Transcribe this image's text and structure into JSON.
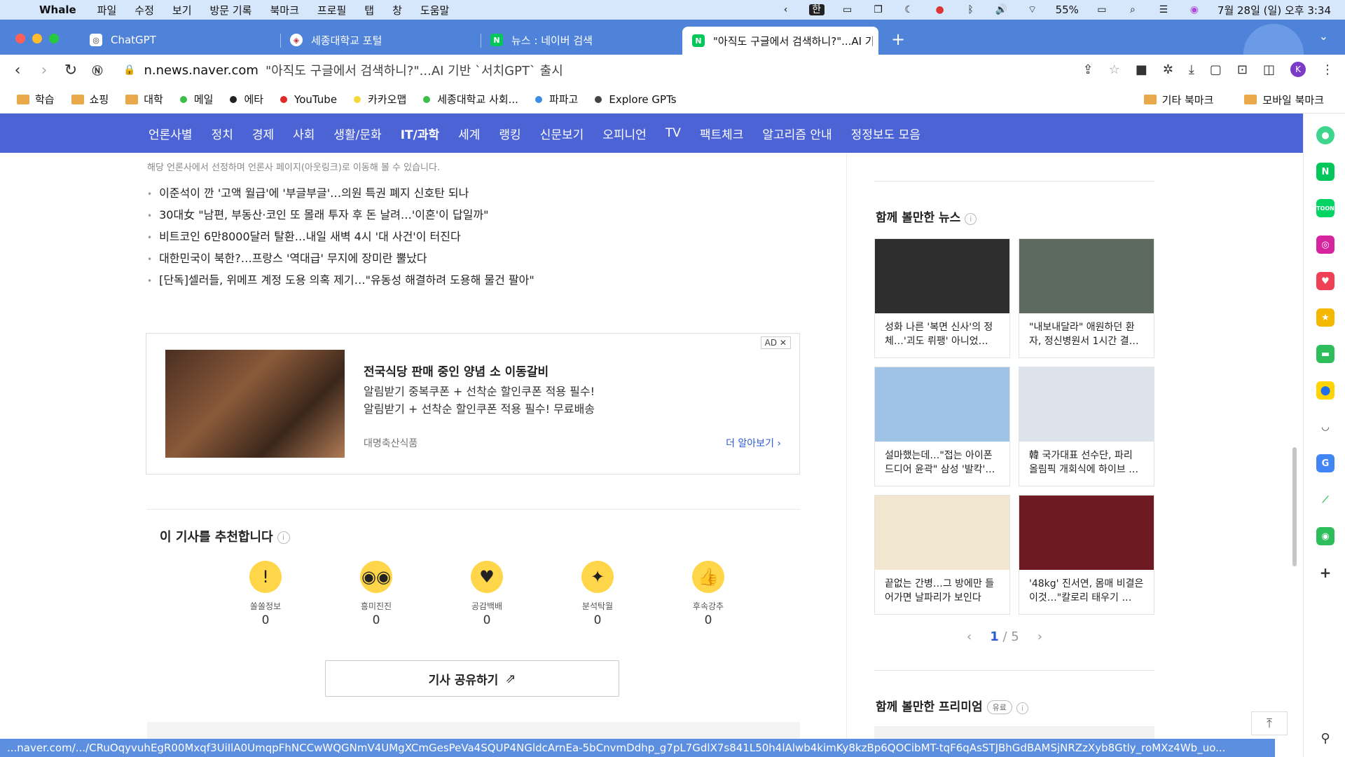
{
  "menubar": {
    "app_name": "Whale",
    "items": [
      "파일",
      "수정",
      "보기",
      "방문 기록",
      "북마크",
      "프로필",
      "탭",
      "창",
      "도움말"
    ],
    "ime": "한",
    "battery": "55%",
    "datetime": "7월 28일 (일) 오후 3:34"
  },
  "tabs": [
    {
      "title": "ChatGPT",
      "icon": "chatgpt-icon"
    },
    {
      "title": "세종대학교 포털",
      "icon": "sejong-icon"
    },
    {
      "title": "뉴스 : 네이버 검색",
      "icon": "naver-icon"
    },
    {
      "title": "\"아직도 구글에서 검색하니?\"...AI 기",
      "icon": "naver-icon",
      "active": true
    }
  ],
  "toolbar": {
    "host": "n.news.naver.com",
    "path": "\"아직도 구글에서 검색하니?\"...AI 기반 `서치GPT` 출시",
    "avatar": "K"
  },
  "bookmarks": {
    "items": [
      {
        "label": "학습",
        "type": "folder"
      },
      {
        "label": "쇼핑",
        "type": "folder"
      },
      {
        "label": "대학",
        "type": "folder"
      },
      {
        "label": "메일",
        "type": "dot",
        "color": "#3cbf4a"
      },
      {
        "label": "에타",
        "type": "dot",
        "color": "#222222"
      },
      {
        "label": "YouTube",
        "type": "dot",
        "color": "#e02a2a"
      },
      {
        "label": "카카오맵",
        "type": "dot",
        "color": "#f5d83b"
      },
      {
        "label": "세종대학교 사회...",
        "type": "dot",
        "color": "#3cbf4a"
      },
      {
        "label": "파파고",
        "type": "dot",
        "color": "#3a8ee6"
      },
      {
        "label": "Explore GPTs",
        "type": "dot",
        "color": "#444444"
      }
    ],
    "right": [
      "기타 북마크",
      "모바일 북마크"
    ]
  },
  "section_nav": [
    "언론사별",
    "정치",
    "경제",
    "사회",
    "생활/문화",
    "IT/과학",
    "세계",
    "랭킹",
    "신문보기",
    "오피니언",
    "TV",
    "팩트체크",
    "알고리즘 안내",
    "정정보도 모음"
  ],
  "section_nav_active": "IT/과학",
  "main": {
    "disclaimer": "해당 언론사에서 선정하며 언론사 페이지(아웃링크)로 이동해 볼 수 있습니다.",
    "headlines": [
      "이준석이 깐 '고액 월급'에 '부글부글'…의원 특권 폐지 신호탄 되나",
      "30대女 \"남편, 부동산·코인 또 몰래 투자 후 돈 날려…'이혼'이 답일까\"",
      "비트코인 6만8000달러 탈환…내일 새벽 4시 '대 사건'이 터진다",
      "대한민국이 북한?…프랑스 '역대급' 무지에 장미란 뿔났다",
      "[단독]셀러들, 위메프 계정 도용 의혹 제기…\"유동성 해결하려 도용해 물건 팔아\""
    ],
    "ad": {
      "badge": "AD ✕",
      "title": "전국식당 판매 중인 양념 소 이동갈비",
      "desc1": "알림받기 중복쿠폰 + 선착순 할인쿠폰 적용 필수!",
      "desc2": "알림받기 + 선착순 할인쿠폰 적용 필수! 무료배송",
      "brand": "대명축산식품",
      "more": "더 알아보기 ›"
    },
    "recommend_title": "이 기사를 추천합니다",
    "reactions": [
      {
        "label": "쏠쏠정보",
        "count": "0",
        "emoji": "!"
      },
      {
        "label": "흥미진진",
        "count": "0",
        "emoji": "◉◉"
      },
      {
        "label": "공감백배",
        "count": "0",
        "emoji": "♥"
      },
      {
        "label": "분석탁월",
        "count": "0",
        "emoji": "✦"
      },
      {
        "label": "후속강추",
        "count": "0",
        "emoji": "👍"
      }
    ],
    "share_label": "기사 공유하기"
  },
  "right": {
    "together_title": "함께 볼만한 뉴스",
    "cards": [
      {
        "caption": "성화 나른 '복면 신사'의 정체…'괴도 뤼팽' 아니었…",
        "color": "#2e2e2e"
      },
      {
        "caption": "\"내보내달라\" 애원하던 환자, 정신병원서 1시간 결…",
        "color": "#5c6b5e"
      },
      {
        "caption": "설마했는데…\"접는 아이폰 드디어 윤곽\" 삼성 '발칵'…",
        "color": "#9fc3e6"
      },
      {
        "caption": "韓 국가대표 선수단, 파리 올림픽 개회식에 하이브 …",
        "color": "#dde3ea"
      },
      {
        "caption": "끝없는 간병…그 방에만 들어가면 날파리가 보인다",
        "color": "#f1e6cf"
      },
      {
        "caption": "'48kg' 진서연, 몸매 비결은 이것…\"칼로리 태우기 …",
        "color": "#6e1a22"
      }
    ],
    "pager": {
      "current": "1",
      "sep": "/",
      "total": "5"
    },
    "premium_title": "함께 볼만한 프리미엄",
    "premium_badge": "유료"
  },
  "status_url": "...naver.com/.../CRuOqyvuhEgR00Mxqf3UiIlA0UmqpFhNCCwWQGNmV4UMgXCmGesPeVa4SQUP4NGldcArnEa-5bCnvmDdhp_g7pL7GdlX7s841L50h4lAlwb4kimKy8kzBp6QOCibMT-tqF6qAsSTJBhGdBAMSjNRZzXyb8Gtly_roMXz4Wb_uo...",
  "colors": {
    "tabstrip": "#4f82d9",
    "section_nav": "#4c63d6",
    "menubar": "#d6e6fb",
    "link": "#2f5bd1"
  }
}
